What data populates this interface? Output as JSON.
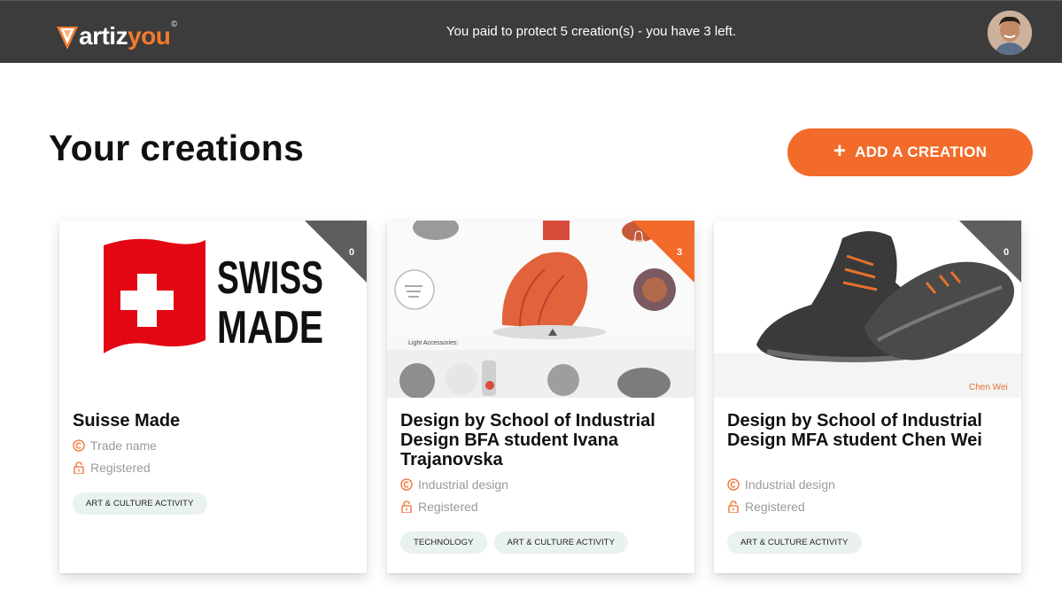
{
  "header": {
    "logo_text_white": "artiz",
    "logo_text_orange": "you",
    "logo_reg": "©",
    "notice": "You paid to protect 5 creation(s) - you have 3 left."
  },
  "main": {
    "title": "Your creations",
    "add_button_label": "ADD A CREATION"
  },
  "cards": [
    {
      "title": "Suisse Made",
      "notifications": "0",
      "category": "Trade name",
      "status": "Registered",
      "tags": [
        "ART & CULTURE ACTIVITY"
      ],
      "image_text_line1": "SWISS",
      "image_text_line2": "MADE"
    },
    {
      "title": "Design by School of Industrial Design BFA student Ivana Trajanovska",
      "notifications": "3",
      "category": "Industrial design",
      "status": "Registered",
      "tags": [
        "TECHNOLOGY",
        "ART & CULTURE ACTIVITY"
      ],
      "image_text_line1": "Light Accessories:"
    },
    {
      "title": "Design by School of Industrial Design MFA student Chen Wei",
      "notifications": "0",
      "category": "Industrial design",
      "status": "Registered",
      "tags": [
        "ART & CULTURE ACTIVITY"
      ],
      "image_text_line1": "Chen Wei"
    }
  ],
  "colors": {
    "brand_orange": "#f26b2a",
    "topbar": "#3c3c3c",
    "badge_grey": "#5e5e5e",
    "badge_orange": "#f26b2a",
    "tag_bg": "#e9f2ef"
  },
  "icons": {
    "bell": "bell-icon",
    "copyright": "copyright-icon",
    "lock": "lock-icon",
    "plus": "plus-icon"
  }
}
